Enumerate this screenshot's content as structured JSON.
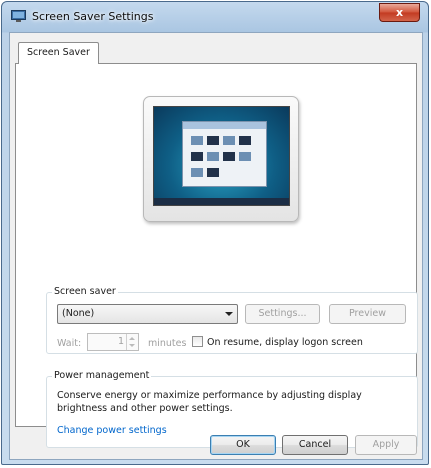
{
  "window": {
    "title": "Screen Saver Settings",
    "close_symbol": "x"
  },
  "tabs": [
    {
      "label": "Screen Saver",
      "selected": true
    }
  ],
  "screen_saver": {
    "group_label": "Screen saver",
    "selected": "(None)",
    "settings_button": "Settings...",
    "preview_button": "Preview",
    "wait_label": "Wait:",
    "wait_value": "1",
    "minutes_label": "minutes",
    "resume_checkbox_label": "On resume, display logon screen",
    "resume_checked": false
  },
  "power_management": {
    "group_label": "Power management",
    "description": "Conserve energy or maximize performance by adjusting display brightness and other power settings.",
    "link": "Change power settings"
  },
  "buttons": {
    "ok": "OK",
    "cancel": "Cancel",
    "apply": "Apply"
  },
  "colors": {
    "link": "#0066cc",
    "close_button": "#c33a22",
    "title_bar": "#aac6e2",
    "screen": "#0f5f86"
  },
  "icons": [
    "screen-saver-app-icon",
    "close-icon",
    "dropdown-arrow-icon",
    "spinner-up-icon",
    "spinner-down-icon"
  ]
}
